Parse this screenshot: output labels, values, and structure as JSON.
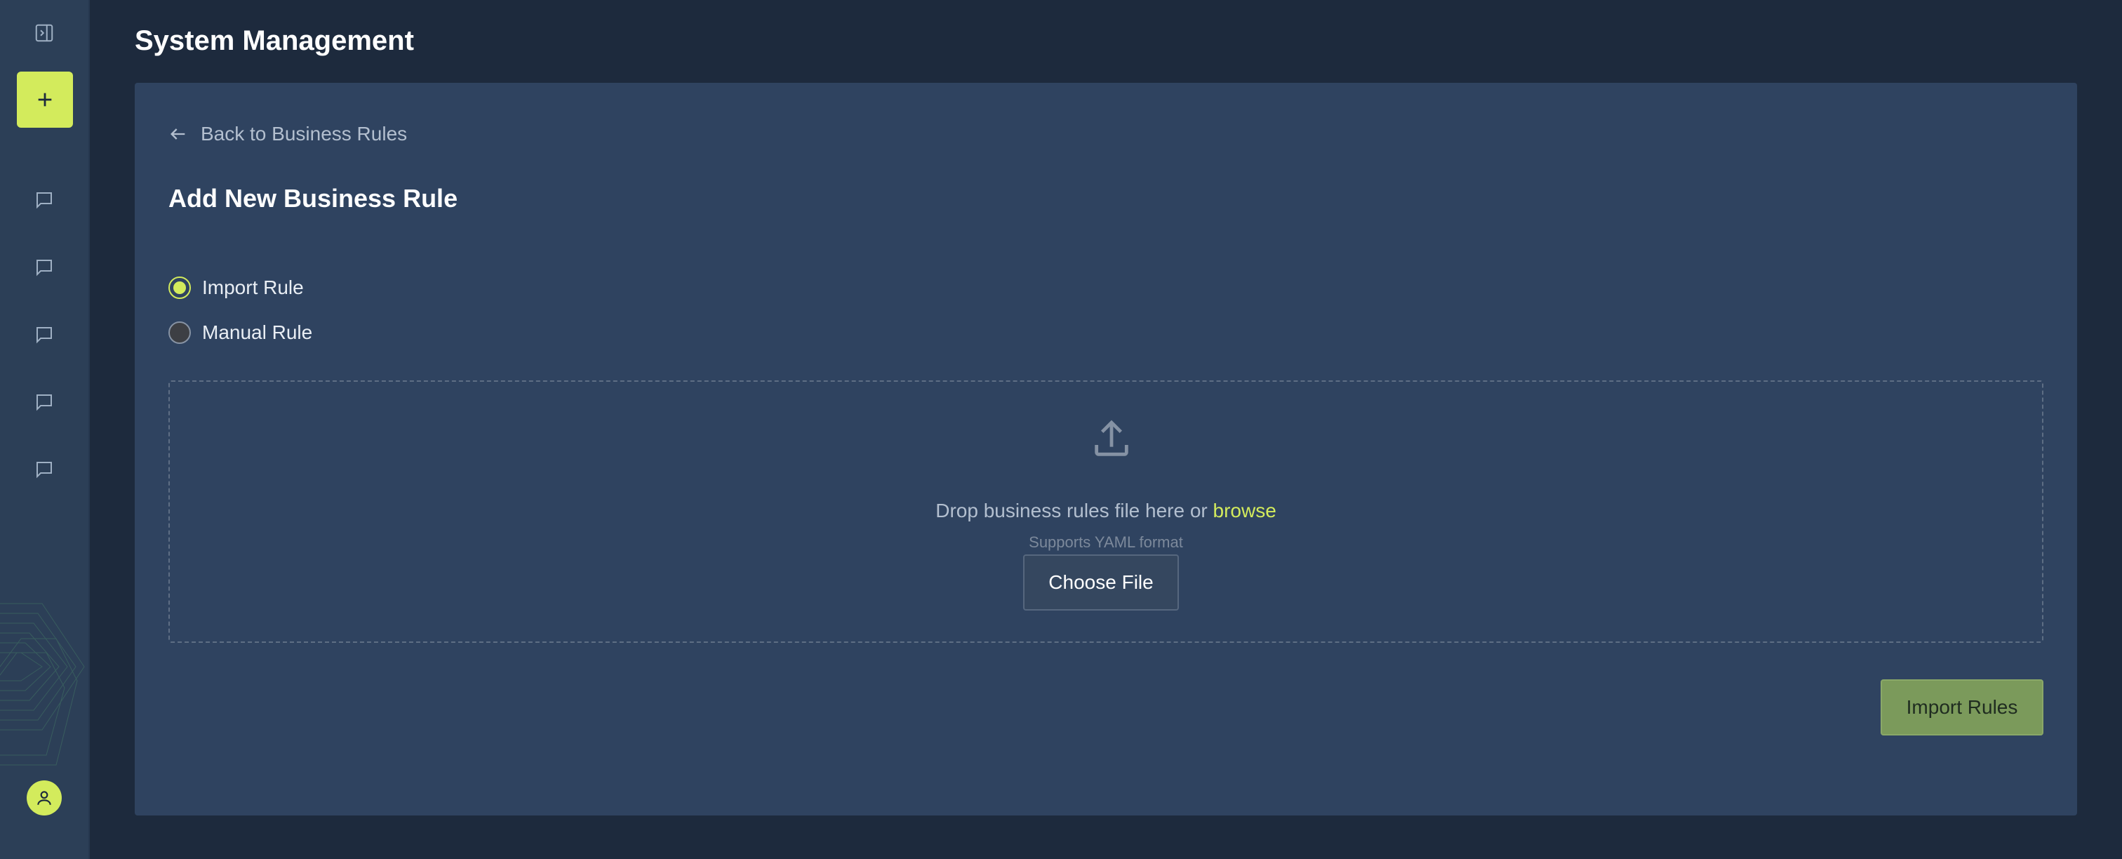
{
  "header": {
    "title": "System Management"
  },
  "sidebar": {
    "toggle_icon": "sidebar-toggle-icon",
    "add_icon": "plus-icon",
    "chat_items": [
      {
        "icon": "chat-bubble-icon"
      },
      {
        "icon": "chat-bubble-icon"
      },
      {
        "icon": "chat-bubble-icon"
      },
      {
        "icon": "chat-bubble-icon"
      },
      {
        "icon": "chat-bubble-icon"
      }
    ],
    "avatar_icon": "user-icon"
  },
  "main": {
    "back_link": "Back to Business Rules",
    "section_title": "Add New Business Rule",
    "options": [
      {
        "label": "Import Rule",
        "checked": true
      },
      {
        "label": "Manual Rule",
        "checked": false
      }
    ],
    "dropzone": {
      "text": "Drop business rules file here or ",
      "browse": "browse",
      "subtext": "Supports YAML format",
      "choose_button": "Choose File"
    },
    "import_button": "Import Rules"
  },
  "colors": {
    "accent": "#d3eb5c",
    "background": "#1d2a3d",
    "panel": "#2f4360",
    "sidebar": "#2c3f57",
    "import_button": "#7b9a5b"
  }
}
